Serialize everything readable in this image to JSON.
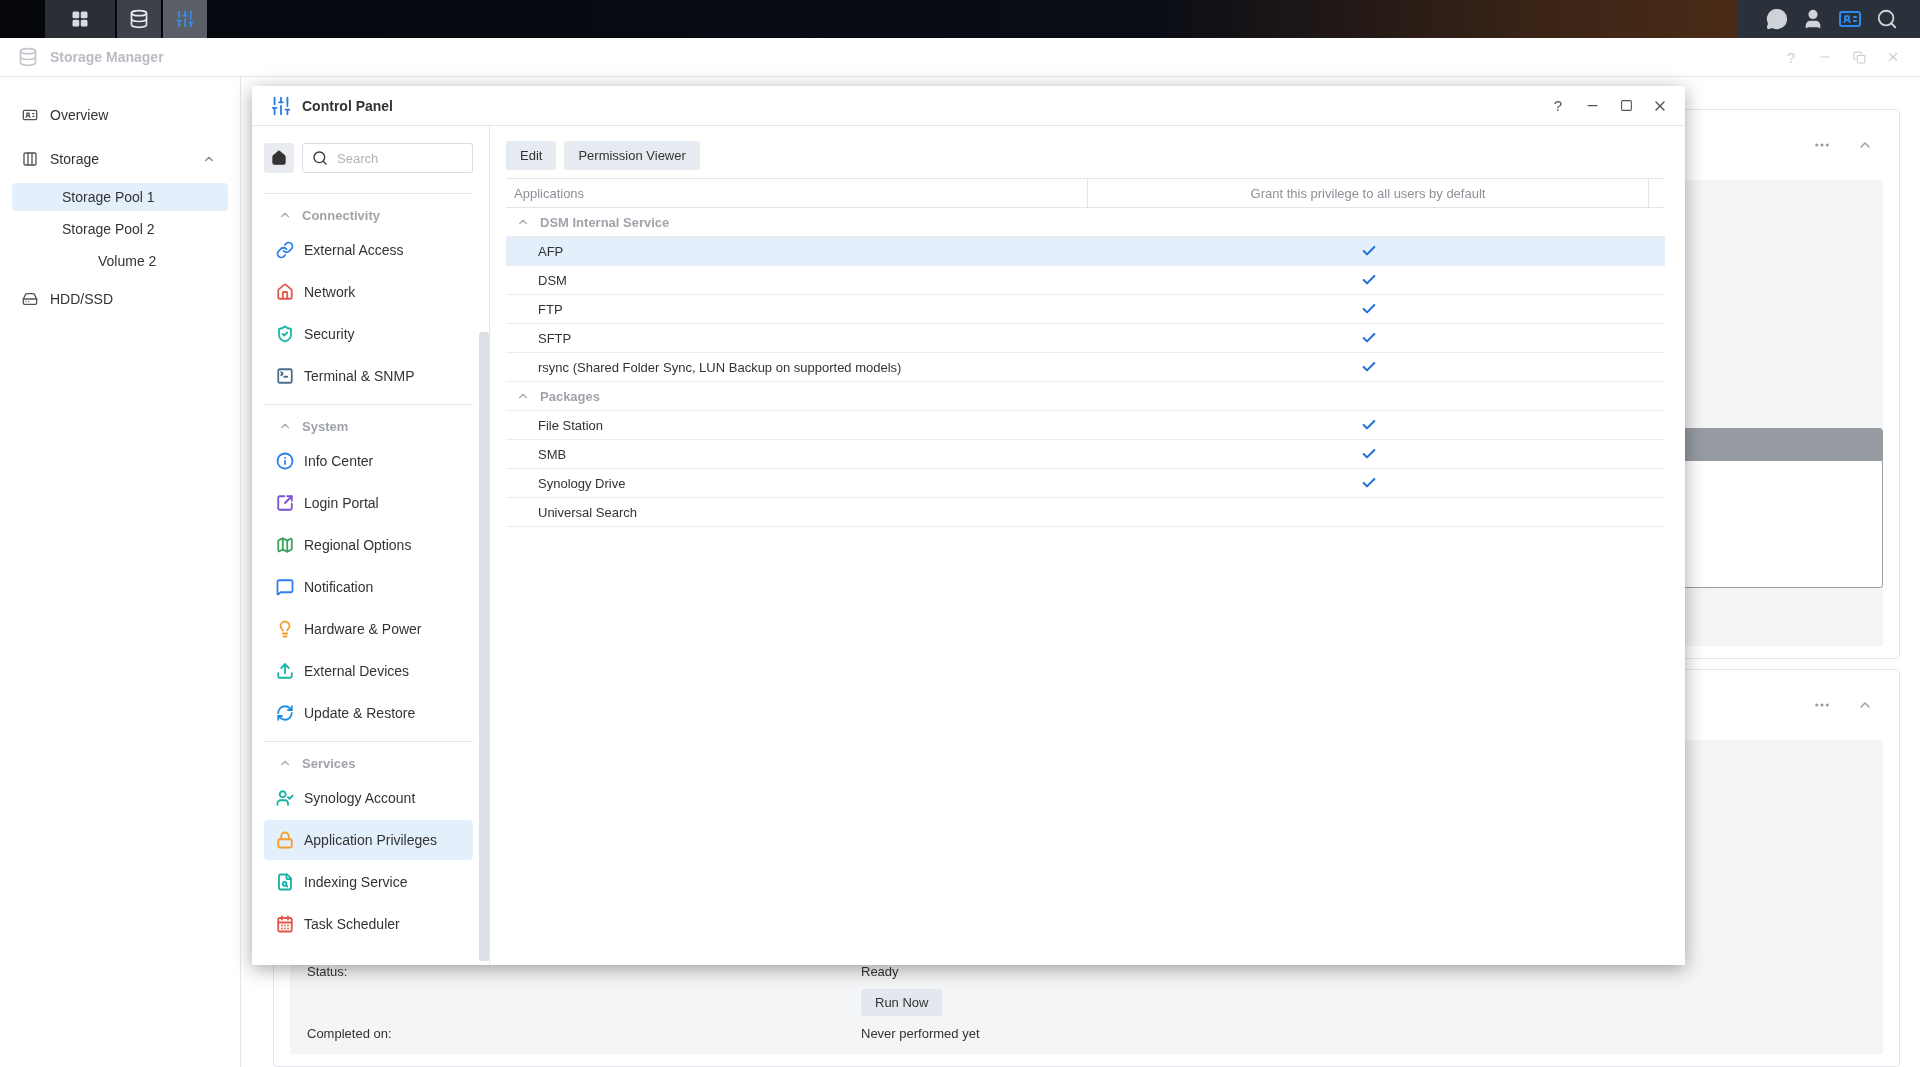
{
  "taskbar": {
    "apps": [
      {
        "selected": false
      },
      {
        "selected": true
      }
    ]
  },
  "storage_manager": {
    "title": "Storage Manager",
    "help": "?",
    "sidebar": {
      "items": [
        {
          "label": "Overview",
          "selected": false
        },
        {
          "label": "Storage",
          "selected": false,
          "expanded": true,
          "children": [
            {
              "label": "Storage Pool 1",
              "selected": true
            },
            {
              "label": "Storage Pool 2",
              "selected": false,
              "children": [
                {
                  "label": "Volume 2",
                  "selected": false
                }
              ]
            }
          ]
        },
        {
          "label": "HDD/SSD",
          "selected": false
        }
      ]
    },
    "task": {
      "rows": [
        {
          "kind": "text",
          "label": "Status:",
          "value": "Ready"
        },
        {
          "kind": "button",
          "label": "Run Now"
        },
        {
          "kind": "text",
          "label": "Completed on:",
          "value": "Never performed yet"
        }
      ]
    }
  },
  "control_panel": {
    "title": "Control Panel",
    "help": "?",
    "search": {
      "placeholder": "Search"
    },
    "sections": [
      {
        "title": "Connectivity",
        "expanded": true,
        "items": [
          {
            "label": "External Access",
            "selected": false
          },
          {
            "label": "Network",
            "selected": false
          },
          {
            "label": "Security",
            "selected": false
          },
          {
            "label": "Terminal & SNMP",
            "selected": false
          }
        ]
      },
      {
        "title": "System",
        "expanded": true,
        "items": [
          {
            "label": "Info Center",
            "selected": false
          },
          {
            "label": "Login Portal",
            "selected": false
          },
          {
            "label": "Regional Options",
            "selected": false
          },
          {
            "label": "Notification",
            "selected": false
          },
          {
            "label": "Hardware & Power",
            "selected": false
          },
          {
            "label": "External Devices",
            "selected": false
          },
          {
            "label": "Update & Restore",
            "selected": false
          }
        ]
      },
      {
        "title": "Services",
        "expanded": true,
        "items": [
          {
            "label": "Synology Account",
            "selected": false
          },
          {
            "label": "Application Privileges",
            "selected": true
          },
          {
            "label": "Indexing Service",
            "selected": false
          },
          {
            "label": "Task Scheduler",
            "selected": false
          }
        ]
      }
    ],
    "toolbar": [
      "Edit",
      "Permission Viewer"
    ],
    "table": {
      "columns": [
        "Applications",
        "Grant this privilege to all users by default"
      ],
      "groups": [
        {
          "title": "DSM Internal Service",
          "expanded": true,
          "rows": [
            {
              "name": "AFP",
              "granted": true,
              "selected": true
            },
            {
              "name": "DSM",
              "granted": true,
              "selected": false
            },
            {
              "name": "FTP",
              "granted": true,
              "selected": false
            },
            {
              "name": "SFTP",
              "granted": true,
              "selected": false
            },
            {
              "name": "rsync (Shared Folder Sync, LUN Backup on supported models)",
              "granted": true,
              "selected": false
            }
          ]
        },
        {
          "title": "Packages",
          "expanded": true,
          "rows": [
            {
              "name": "File Station",
              "granted": true,
              "selected": false
            },
            {
              "name": "SMB",
              "granted": true,
              "selected": false
            },
            {
              "name": "Synology Drive",
              "granted": true,
              "selected": false
            },
            {
              "name": "Universal Search",
              "granted": false,
              "selected": false
            }
          ]
        }
      ]
    }
  }
}
